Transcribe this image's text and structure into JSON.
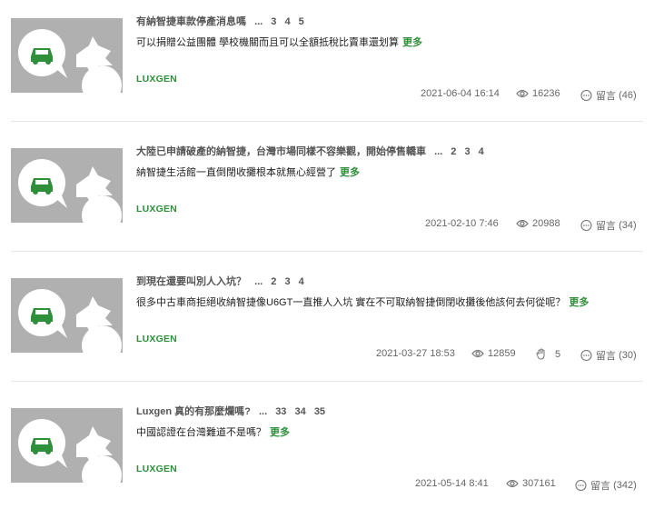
{
  "posts": [
    {
      "title": "有納智捷車款停產消息嗎",
      "ellipsis": "...",
      "pages": [
        "3",
        "4",
        "5"
      ],
      "excerpt": "可以捐贈公益團體 學校機關而且可以全額抵稅比賣車還划算",
      "more": "更多",
      "brand": "LUXGEN",
      "date": "2021-06-04 16:14",
      "views": "16236",
      "likes": null,
      "comments_label": "留言",
      "comments": "(46)"
    },
    {
      "title": "大陸已申請破產的納智捷，台灣市場同樣不容樂觀，開始停售轎車",
      "ellipsis": "...",
      "pages": [
        "2",
        "3",
        "4"
      ],
      "excerpt": "納智捷生活館一直倒閉收攤根本就無心經營了",
      "more": "更多",
      "brand": "LUXGEN",
      "date": "2021-02-10 7:46",
      "views": "20988",
      "likes": null,
      "comments_label": "留言",
      "comments": "(34)"
    },
    {
      "title": "到現在還要叫別人入坑？",
      "ellipsis": "...",
      "pages": [
        "2",
        "3",
        "4"
      ],
      "excerpt": "很多中古車商拒絕收納智捷像U6GT一直推人入坑 實在不可取納智捷倒閉收攤後他該何去何從呢？",
      "more": "更多",
      "brand": "LUXGEN",
      "date": "2021-03-27 18:53",
      "views": "12859",
      "likes": "5",
      "comments_label": "留言",
      "comments": "(30)"
    },
    {
      "title": "Luxgen 真的有那麼爛嗎?",
      "ellipsis": "...",
      "pages": [
        "33",
        "34",
        "35"
      ],
      "excerpt": "中國認證在台灣難道不是嗎？",
      "more": "更多",
      "brand": "LUXGEN",
      "date": "2021-05-14 8:41",
      "views": "307161",
      "likes": null,
      "comments_label": "留言",
      "comments": "(342)"
    }
  ],
  "icons": {
    "thumbnail": "car-speech-bubble-icon",
    "views": "eye-icon",
    "likes": "clap-icon",
    "comments": "speech-bubble-icon"
  },
  "colors": {
    "accent": "#2f8f3a",
    "thumb_bg": "#b0b0b0"
  }
}
